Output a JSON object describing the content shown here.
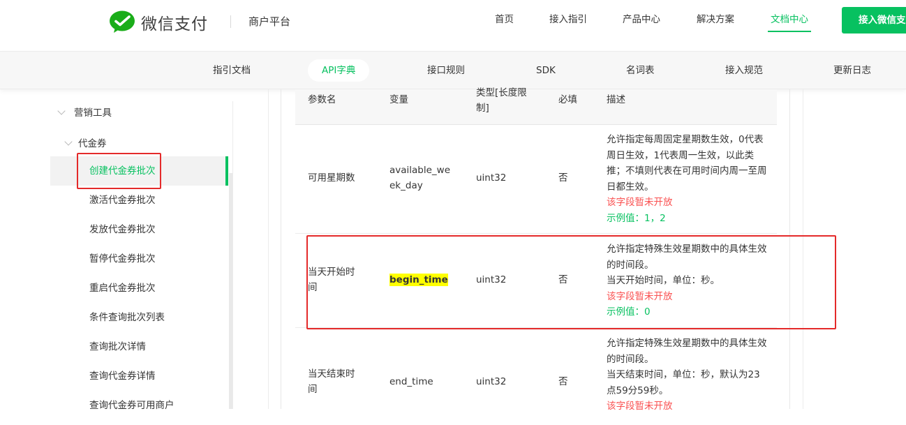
{
  "header": {
    "brand": "微信支付",
    "platform": "商户平台",
    "nav": [
      "首页",
      "接入指引",
      "产品中心",
      "解决方案",
      "文档中心"
    ],
    "active_nav": "文档中心",
    "cta": "接入微信支付"
  },
  "subnav": {
    "items": [
      "指引文档",
      "API字典",
      "接口规则",
      "SDK",
      "名词表",
      "接入规范",
      "更新日志"
    ],
    "active": "API字典"
  },
  "sidebar": {
    "group": "营销工具",
    "subgroup": "代金券",
    "items": [
      "创建代金券批次",
      "激活代金券批次",
      "发放代金券批次",
      "暂停代金券批次",
      "重启代金券批次",
      "条件查询批次列表",
      "查询批次详情",
      "查询代金券详情",
      "查询代金券可用商户"
    ],
    "active": "创建代金券批次"
  },
  "table": {
    "headers": {
      "name": "参数名",
      "var": "变量",
      "type": "类型[长度限制]",
      "required": "必填",
      "desc": "描述"
    },
    "rows": [
      {
        "name": "可用星期数",
        "var": "available_week_day",
        "type": "uint32",
        "required": "否",
        "desc": "允许指定每周固定星期数生效，0代表周日生效，1代表周一生效，以此类推；不填则代表在可用时间内周一至周日都生效。",
        "warn": "该字段暂未开放",
        "example": "示例值：1，2"
      },
      {
        "name": "当天开始时间",
        "var": "begin_time",
        "type": "uint32",
        "required": "否",
        "desc": "允许指定特殊生效星期数中的具体生效的时间段。",
        "desc2": "当天开始时间，单位：秒。",
        "warn": "该字段暂未开放",
        "example": "示例值：0"
      },
      {
        "name": "当天结束时间",
        "var": "end_time",
        "type": "uint32",
        "required": "否",
        "desc": "允许指定特殊生效星期数中的具体生效的时间段。",
        "desc2": "当天结束时间，单位：秒，默认为23点59分59秒。",
        "warn": "该字段暂未开放"
      }
    ]
  },
  "colors": {
    "accent": "#07c160",
    "annotation": "#e42a2a",
    "warning": "#fa5151",
    "highlight": "#ffff00"
  },
  "icons": [
    "wechat-pay-logo-icon",
    "chevron-down-icon"
  ]
}
